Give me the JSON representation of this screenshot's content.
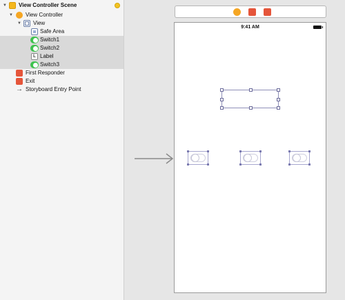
{
  "outline": {
    "items": [
      {
        "label": "View Controller Scene",
        "icon": "scene-icon"
      },
      {
        "label": "View Controller",
        "icon": "view-controller-icon"
      },
      {
        "label": "View",
        "icon": "view-icon"
      },
      {
        "label": "Safe Area",
        "icon": "safe-area-icon"
      },
      {
        "label": "Switch1",
        "icon": "switch-icon"
      },
      {
        "label": "Switch2",
        "icon": "switch-icon"
      },
      {
        "label": "Label",
        "icon": "label-icon",
        "glyph": "L"
      },
      {
        "label": "Switch3",
        "icon": "switch-icon"
      },
      {
        "label": "First Responder",
        "icon": "first-responder-icon"
      },
      {
        "label": "Exit",
        "icon": "exit-icon"
      },
      {
        "label": "Storyboard Entry Point",
        "icon": "arrow-right-icon",
        "glyph": "→"
      }
    ]
  },
  "canvas": {
    "status_time": "9:41 AM"
  },
  "colors": {
    "selection": "#d9d9d9",
    "switch_green": "#3ec24e",
    "vc_orange": "#f5a623",
    "responder_red": "#e5553a",
    "outline_bg": "#f4f4f4",
    "canvas_bg": "#e6e6e6"
  }
}
